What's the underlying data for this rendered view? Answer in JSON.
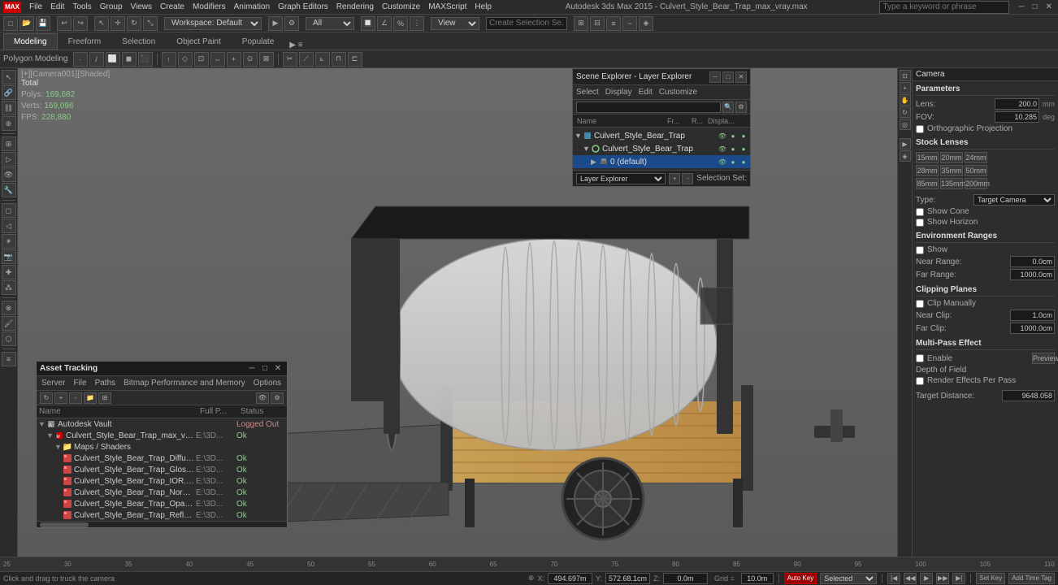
{
  "app": {
    "title": "Autodesk 3ds Max 2015 - Culvert_Style_Bear_Trap_max_vray.max",
    "logo": "MAX"
  },
  "top_menu": {
    "items": [
      "File",
      "Edit",
      "Tools",
      "Group",
      "Views",
      "Create",
      "Modifiers",
      "Animation",
      "Graph Editors",
      "Rendering",
      "Customize",
      "MAXScript",
      "Help"
    ]
  },
  "workspace": {
    "label": "Workspace: Default"
  },
  "search": {
    "placeholder": "Type a keyword or phrase"
  },
  "tabs": {
    "items": [
      "Modeling",
      "Freeform",
      "Selection",
      "Object Paint",
      "Populate"
    ],
    "active": "Modeling",
    "sub_label": "Polygon Modeling"
  },
  "viewport": {
    "label": "[+][Camera001][Shaded]",
    "stats": {
      "polys_label": "Polys:",
      "polys_val": "169,682",
      "verts_label": "Verts:",
      "verts_val": "169,096",
      "fps_label": "FPS:",
      "fps_val": "228,880",
      "total_label": "Total"
    }
  },
  "scene_explorer": {
    "title": "Scene Explorer - Layer Explorer",
    "menu": [
      "Select",
      "Display",
      "Edit",
      "Customize"
    ],
    "columns": {
      "name": "Name",
      "fr": "Fr...",
      "r": "R...",
      "disp": "Displa..."
    },
    "rows": [
      {
        "level": 0,
        "expand": "▼",
        "icon": "scene-icon",
        "name": "Culvert_Style_Bear_Trap",
        "selected": false,
        "has_icons": true
      },
      {
        "level": 1,
        "expand": "▼",
        "icon": "layer-icon",
        "name": "Culvert_Style_Bear_Trap",
        "selected": false,
        "has_icons": true
      },
      {
        "level": 2,
        "expand": "▶",
        "icon": "layer-icon",
        "name": "0 (default)",
        "selected": true,
        "has_icons": true
      }
    ],
    "footer": {
      "dropdown_label": "Layer Explorer",
      "selection_label": "Selection Set:"
    }
  },
  "camera_panel": {
    "title": "Camera",
    "parameters_title": "Parameters",
    "lens_label": "Lens:",
    "lens_val": "200.0",
    "lens_unit": "mm",
    "fov_label": "FOV:",
    "fov_val": "10.285",
    "fov_unit": "deg",
    "ortho_label": "Orthographic Projection",
    "stock_lenses_title": "Stock Lenses",
    "lenses": [
      "15mm",
      "20mm",
      "24mm",
      "28mm",
      "35mm",
      "50mm",
      "85mm",
      "135mm",
      "200mm"
    ],
    "type_label": "Type:",
    "type_val": "Target Camera",
    "show_cone_label": "Show Cone",
    "show_horizon_label": "Show Horizon",
    "env_ranges_title": "Environment Ranges",
    "show_label": "Show",
    "near_range_label": "Near Range:",
    "near_range_val": "0.0cm",
    "far_range_label": "Far Range:",
    "far_range_val": "1000.0cm",
    "clipping_planes_title": "Clipping Planes",
    "clip_manually_label": "Clip Manually",
    "near_clip_label": "Near Clip:",
    "near_clip_val": "1.0cm",
    "far_clip_label": "Far Clip:",
    "far_clip_val": "1000.0cm",
    "multi_pass_title": "Multi-Pass Effect",
    "enable_label": "Enable",
    "preview_label": "Preview",
    "dof_title": "Depth of Field",
    "render_effects_label": "Render Effects Per Pass",
    "target_dist_label": "Target Distance:",
    "target_dist_val": "9648.058"
  },
  "asset_tracking": {
    "title": "Asset Tracking",
    "menu": [
      "Server",
      "File",
      "Paths",
      "Bitmap Performance and Memory",
      "Options"
    ],
    "columns": {
      "name": "Name",
      "full_path": "Full P...",
      "status": "Status"
    },
    "rows": [
      {
        "level": 0,
        "expand": "▼",
        "type": "vault",
        "name": "Autodesk Vault",
        "path": "",
        "status": "Logged Out",
        "status_class": "logout"
      },
      {
        "level": 1,
        "expand": "▼",
        "type": "file",
        "name": "Culvert_Style_Bear_Trap_max_vray.max",
        "path": "E:\\3D...",
        "status": "Ok",
        "status_class": "ok"
      },
      {
        "level": 2,
        "expand": "▼",
        "type": "folder",
        "name": "Maps / Shaders",
        "path": "",
        "status": "",
        "status_class": ""
      },
      {
        "level": 3,
        "expand": "",
        "type": "bitmap",
        "name": "Culvert_Style_Bear_Trap_Diffuse.png",
        "path": "E:\\3D...",
        "status": "Ok",
        "status_class": "ok"
      },
      {
        "level": 3,
        "expand": "",
        "type": "bitmap",
        "name": "Culvert_Style_Bear_Trap_Glossiness.png",
        "path": "E:\\3D...",
        "status": "Ok",
        "status_class": "ok"
      },
      {
        "level": 3,
        "expand": "",
        "type": "bitmap",
        "name": "Culvert_Style_Bear_Trap_IOR.png",
        "path": "E:\\3D...",
        "status": "Ok",
        "status_class": "ok"
      },
      {
        "level": 3,
        "expand": "",
        "type": "bitmap",
        "name": "Culvert_Style_Bear_Trap_Normal.png",
        "path": "E:\\3D...",
        "status": "Ok",
        "status_class": "ok"
      },
      {
        "level": 3,
        "expand": "",
        "type": "bitmap",
        "name": "Culvert_Style_Bear_Trap_Opacity.png",
        "path": "E:\\3D...",
        "status": "Ok",
        "status_class": "ok"
      },
      {
        "level": 3,
        "expand": "",
        "type": "bitmap",
        "name": "Culvert_Style_Bear_Trap_Reflection.png",
        "path": "E:\\3D...",
        "status": "Ok",
        "status_class": "ok"
      }
    ]
  },
  "bottom_bar": {
    "status_text": "Click and drag to truck the camera",
    "coords": {
      "x_label": "X:",
      "x_val": "494.697m",
      "y_label": "Y:",
      "y_val": "572.68.1cm",
      "z_label": "Z:",
      "z_val": "0.0m"
    },
    "grid_label": "Grid =",
    "grid_val": "10.0m",
    "auto_key_label": "Auto Key",
    "selected_label": "Selected",
    "set_key_label": "Set Key",
    "add_time_tag_label": "Add Time Tag"
  },
  "timeline": {
    "markers": [
      "25",
      "30",
      "35",
      "40",
      "45",
      "50",
      "55",
      "60",
      "65",
      "70",
      "75",
      "80",
      "85",
      "90",
      "95",
      "100",
      "105",
      "110"
    ]
  }
}
